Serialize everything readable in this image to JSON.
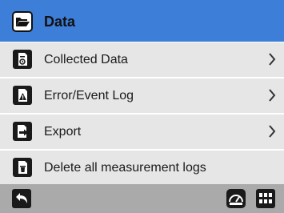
{
  "header": {
    "title": "Data",
    "icon": "folder-open-icon"
  },
  "menu": [
    {
      "label": "Collected Data",
      "icon": "collected-data-icon",
      "has_chevron": true
    },
    {
      "label": "Error/Event Log",
      "icon": "warning-document-icon",
      "has_chevron": true
    },
    {
      "label": "Export",
      "icon": "export-document-icon",
      "has_chevron": true
    },
    {
      "label": "Delete all measurement logs",
      "icon": "delete-document-icon",
      "has_chevron": false
    }
  ],
  "footer": {
    "back_icon": "back-arrow-icon",
    "gauge_icon": "gauge-icon",
    "grid_icon": "grid-icon"
  },
  "colors": {
    "header": "#3d7ed9",
    "menu_item": "#e6e6e6",
    "footer": "#aaaaaa"
  }
}
